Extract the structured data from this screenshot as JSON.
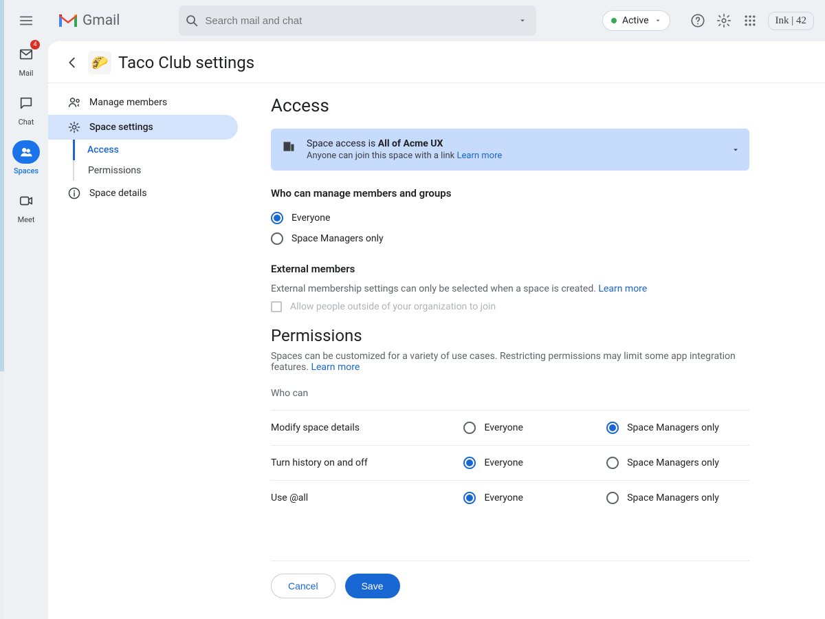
{
  "header": {
    "product": "Gmail",
    "search_placeholder": "Search mail and chat",
    "status": "Active",
    "right_badge": "Ink | 42"
  },
  "rail": {
    "mail": {
      "label": "Mail",
      "badge": "4"
    },
    "chat": {
      "label": "Chat"
    },
    "spaces": {
      "label": "Spaces"
    },
    "meet": {
      "label": "Meet"
    }
  },
  "card": {
    "title": "Taco Club settings",
    "icon": "🌮"
  },
  "nav": {
    "manage_members": "Manage members",
    "space_settings": "Space settings",
    "sub": {
      "access": "Access",
      "permissions": "Permissions"
    },
    "space_details": "Space details"
  },
  "access": {
    "heading": "Access",
    "banner_prefix": "Space access is ",
    "banner_org": "All of Acme UX",
    "banner_sub": "Anyone can join this space with a link ",
    "learn_more": "Learn more",
    "manage_q": "Who can manage members and groups",
    "opt_everyone": "Everyone",
    "opt_managers": "Space Managers only",
    "manage_selected": "everyone"
  },
  "external": {
    "heading": "External members",
    "desc": "External membership settings can only be selected when a space is created. ",
    "learn_more": "Learn more",
    "checkbox_label": "Allow people outside of your organization to join"
  },
  "permissions": {
    "heading": "Permissions",
    "desc": "Spaces can be customized for a variety of use cases. Restricting permissions may limit some app integration features. ",
    "learn_more": "Learn more",
    "who_can": "Who can",
    "col_everyone": "Everyone",
    "col_managers": "Space Managers only",
    "rows": [
      {
        "label": "Modify space details",
        "selected": "managers"
      },
      {
        "label": "Turn history on and off",
        "selected": "everyone"
      },
      {
        "label": "Use @all",
        "selected": "everyone"
      }
    ]
  },
  "footer": {
    "cancel": "Cancel",
    "save": "Save"
  }
}
